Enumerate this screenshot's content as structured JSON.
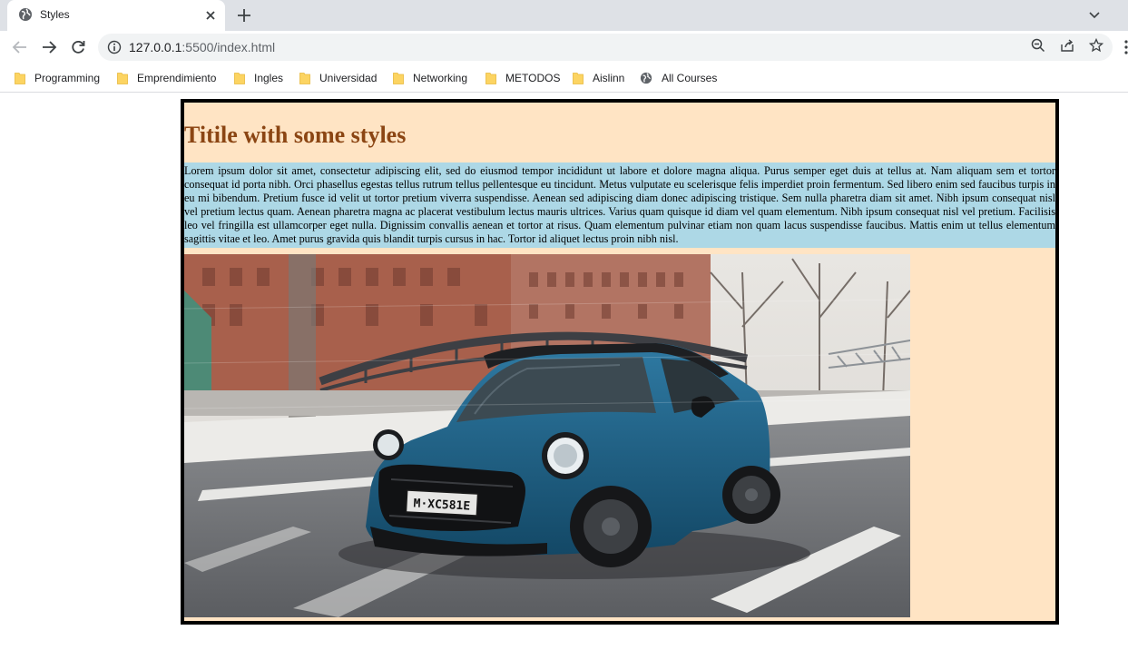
{
  "tab": {
    "title": "Styles"
  },
  "omnibox": {
    "url_host": "127.0.0.1",
    "url_path": ":5500/index.html"
  },
  "bookmarks": [
    {
      "label": "Programming",
      "icon": "folder-icon"
    },
    {
      "label": "Emprendimiento",
      "icon": "folder-icon"
    },
    {
      "label": "Ingles",
      "icon": "folder-icon"
    },
    {
      "label": "Universidad",
      "icon": "folder-icon"
    },
    {
      "label": "Networking",
      "icon": "folder-icon"
    },
    {
      "label": "METODOS",
      "icon": "folder-icon"
    },
    {
      "label": "Aislinn",
      "icon": "folder-icon"
    },
    {
      "label": "All Courses",
      "icon": "globe-icon"
    }
  ],
  "page": {
    "title": "Titile with some styles",
    "paragraph": "Lorem ipsum dolor sit amet, consectetur adipiscing elit, sed do eiusmod tempor incididunt ut labore et dolore magna aliqua. Purus semper eget duis at tellus at. Nam aliquam sem et tortor consequat id porta nibh. Orci phasellus egestas tellus rutrum tellus pellentesque eu tincidunt. Metus vulputate eu scelerisque felis imperdiet proin fermentum. Sed libero enim sed faucibus turpis in eu mi bibendum. Pretium fusce id velit ut tortor pretium viverra suspendisse. Aenean sed adipiscing diam donec adipiscing tristique. Sem nulla pharetra diam sit amet. Nibh ipsum consequat nisl vel pretium lectus quam. Aenean pharetra magna ac placerat vestibulum lectus mauris ultrices. Varius quam quisque id diam vel quam elementum. Nibh ipsum consequat nisl vel pretium. Facilisis leo vel fringilla est ullamcorper eget nulla. Dignissim convallis aenean et tortor at risus. Quam elementum pulvinar etiam non quam lacus suspendisse faucibus. Mattis enim ut tellus elementum sagittis vitae et leo. Amet purus gravida quis blandit turpis cursus in hac. Tortor id aliquet lectus proin nibh nisl.",
    "image_plate": "M·XC581E"
  },
  "colors": {
    "page_bg": "#ffe4c4",
    "title": "#8b4513",
    "paragraph_bg": "#add8e6",
    "border": "#000000",
    "car": "#1f5f84"
  }
}
